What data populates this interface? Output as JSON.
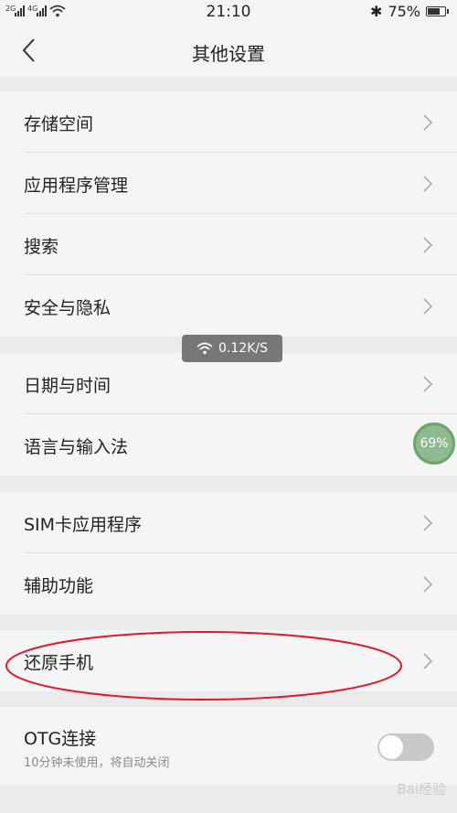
{
  "status_bar": {
    "signal_1": "2G",
    "signal_2": "4G",
    "time": "21:10",
    "bluetooth": "✱",
    "battery_percent": "75%",
    "battery_level": 0.75
  },
  "header": {
    "title": "其他设置"
  },
  "groups": {
    "g1": [
      "存储空间",
      "应用程序管理",
      "搜索",
      "安全与隐私"
    ],
    "g2": [
      "日期与时间",
      "语言与输入法"
    ],
    "g3": [
      "SIM卡应用程序",
      "辅助功能"
    ],
    "g4": [
      "还原手机"
    ],
    "g5": {
      "label": "OTG连接",
      "sublabel": "10分钟未使用，将自动关闭",
      "toggle_on": false
    }
  },
  "overlay": {
    "network_speed": "0.12K/S",
    "memory_ball": "69%"
  },
  "watermark": "Bai经验"
}
